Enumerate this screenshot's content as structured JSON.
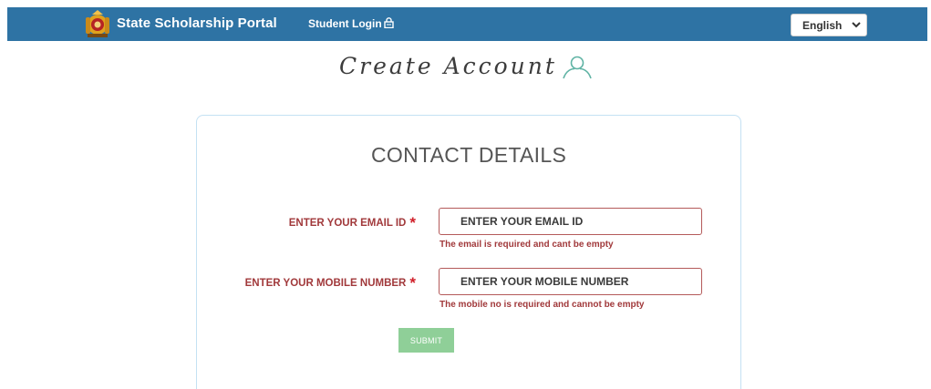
{
  "header": {
    "brand_title": "State Scholarship Portal",
    "student_login_label": "Student Login",
    "student_login_icon": "lock-icon",
    "language": {
      "selected": "English"
    },
    "colors": {
      "bar": "#2e73a4"
    }
  },
  "page": {
    "title": "Create Account",
    "title_icon": "user-icon"
  },
  "form": {
    "section_title": "CONTACT DETAILS",
    "email": {
      "label": "ENTER YOUR EMAIL ID",
      "required_mark": "*",
      "value": "",
      "placeholder": "ENTER YOUR EMAIL ID",
      "error": "The email is required and cant be empty"
    },
    "mobile": {
      "label": "ENTER YOUR MOBILE NUMBER",
      "required_mark": "*",
      "value": "",
      "placeholder": "ENTER YOUR MOBILE NUMBER",
      "error": "The mobile no is required and cannot be empty"
    },
    "submit_label": "SUBMIT",
    "colors": {
      "error": "#a1393b",
      "submit": "#8fcf98"
    }
  }
}
